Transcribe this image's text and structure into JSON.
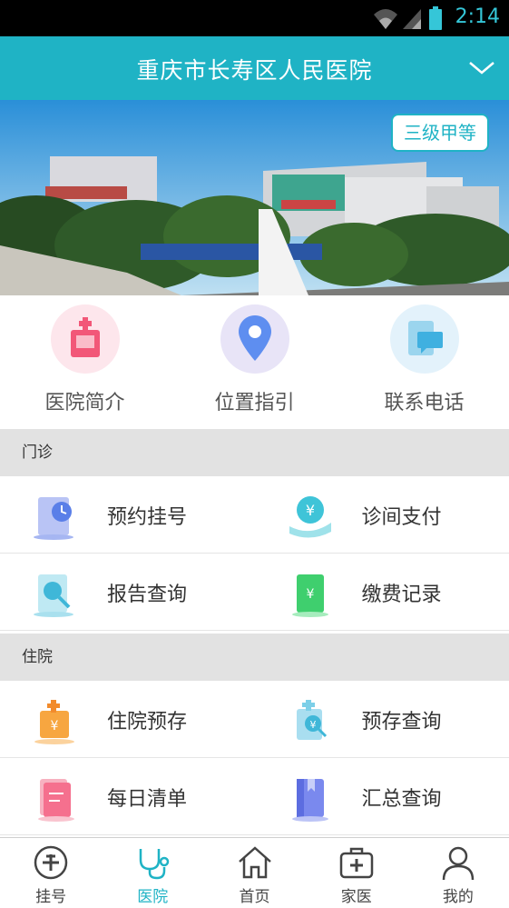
{
  "status": {
    "time": "2:14"
  },
  "header": {
    "title": "重庆市长寿区人民医院"
  },
  "banner": {
    "badge": "三级甲等"
  },
  "quick": [
    {
      "label": "医院简介",
      "icon": "hospital-icon"
    },
    {
      "label": "位置指引",
      "icon": "location-pin-icon"
    },
    {
      "label": "联系电话",
      "icon": "phone-book-icon"
    }
  ],
  "outpatient": {
    "title": "门诊",
    "items": [
      "预约挂号",
      "诊间支付",
      "报告查询",
      "缴费记录"
    ]
  },
  "inpatient": {
    "title": "住院",
    "items": [
      "住院预存",
      "预存查询",
      "每日清单",
      "汇总查询"
    ]
  },
  "tabs": [
    "挂号",
    "医院",
    "首页",
    "家医",
    "我的"
  ],
  "colors": {
    "accent": "#1fb3c5",
    "section_bg": "#e2e2e2"
  }
}
